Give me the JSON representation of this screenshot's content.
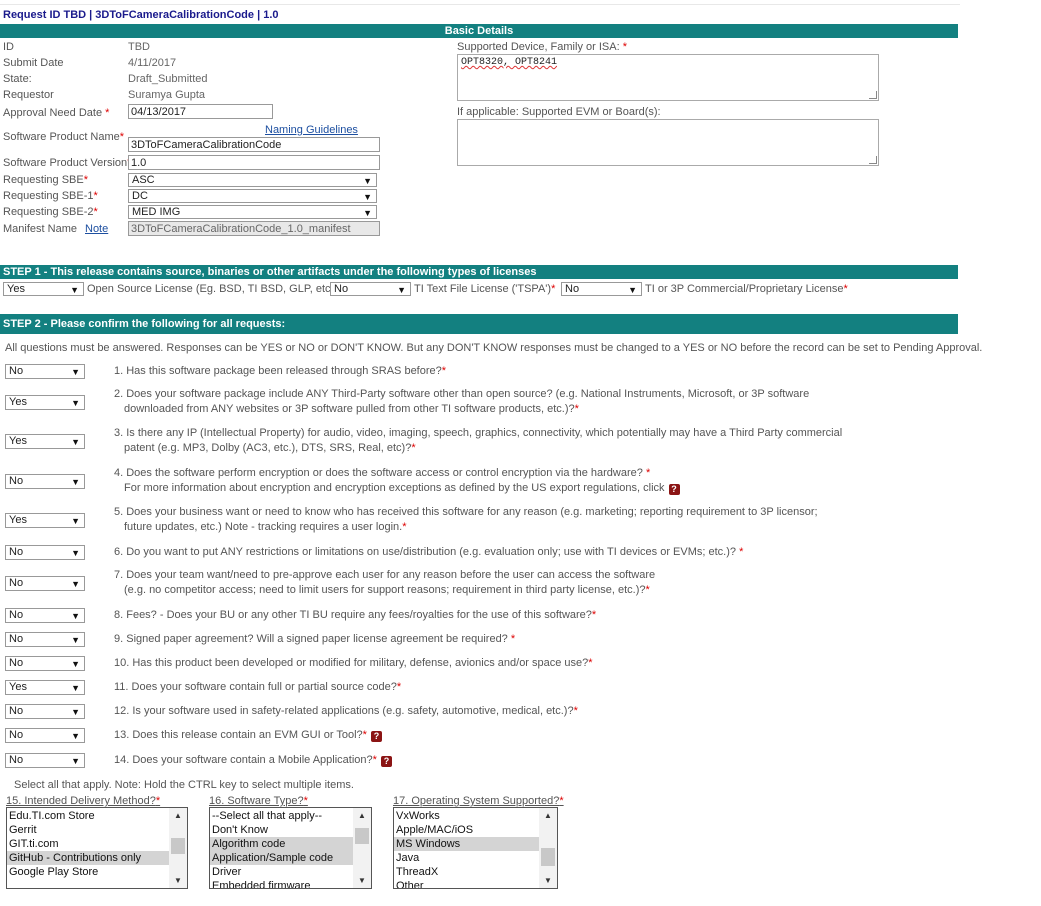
{
  "header": {
    "title": "Request ID TBD | 3DToFCameraCalibrationCode | 1.0"
  },
  "basic": {
    "bar": "Basic Details",
    "id_label": "ID",
    "id_value": "TBD",
    "submit_label": "Submit Date",
    "submit_value": "4/11/2017",
    "state_label": "State:",
    "state_value": "Draft_Submitted",
    "requestor_label": "Requestor",
    "requestor_value": "Suramya Gupta",
    "approval_label": "Approval Need Date",
    "approval_value": "04/13/2017",
    "naming_link": "Naming Guidelines",
    "product_name_label": "Software Product Name",
    "product_name_value": "3DToFCameraCalibrationCode",
    "product_version_label": "Software Product Version",
    "product_version_value": "1.0",
    "sbe_label": "Requesting SBE",
    "sbe_value": "ASC",
    "sbe1_label": "Requesting SBE-1",
    "sbe1_value": "DC",
    "sbe2_label": "Requesting SBE-2",
    "sbe2_value": "MED IMG",
    "manifest_label": "Manifest Name",
    "manifest_link": "Note",
    "manifest_value": "3DToFCameraCalibrationCode_1.0_manifest",
    "device_label": "Supported Device, Family or ISA:",
    "device_value": "OPT8320, OPT8241",
    "evm_label": "If applicable: Supported EVM or Board(s):",
    "evm_value": ""
  },
  "step1": {
    "bar": "STEP 1 - This release contains source, binaries or other artifacts under the following types of licenses",
    "open_value": "Yes",
    "open_label": "Open Source License (Eg. BSD, TI BSD, GLP, etc)",
    "tspa_value": "No",
    "tspa_label": "TI Text File License ('TSPA')",
    "commercial_value": "No",
    "commercial_label": "TI or 3P Commercial/Proprietary License"
  },
  "step2": {
    "bar": "STEP 2 - Please confirm the following for all requests:",
    "intro": "All questions must be answered. Responses can be YES or NO or DON'T KNOW. But any DON'T KNOW responses must be changed to a YES or NO before the record can be set to Pending Approval.",
    "questions": [
      {
        "answer": "No",
        "line1": "1. Has this software package been released through SRAS before?",
        "line2": ""
      },
      {
        "answer": "Yes",
        "line1": "2. Does your software package include ANY Third-Party software other than open source? (e.g. National Instruments, Microsoft, or 3P software",
        "line2": "downloaded from ANY websites or 3P software pulled from other TI software products, etc.)?"
      },
      {
        "answer": "Yes",
        "line1": "3. Is there any IP (Intellectual Property) for audio, video, imaging, speech, graphics, connectivity, which potentially may have a Third Party commercial",
        "line2": "patent (e.g. MP3, Dolby (AC3, etc.), DTS, SRS, Real, etc)?"
      },
      {
        "answer": "No",
        "line1": "4. Does the software perform encryption or does the software access or control encryption via the hardware? ",
        "line2": "For more information about encryption and encryption exceptions as defined by the US export regulations, click"
      },
      {
        "answer": "Yes",
        "line1": "5. Does your business want or need to know who has received this software for any reason (e.g. marketing; reporting requirement to 3P licensor;",
        "line2": "future updates, etc.) Note - tracking requires a user login."
      },
      {
        "answer": "No",
        "line1": "6. Do you want to put ANY restrictions or limitations on use/distribution (e.g. evaluation only; use with TI devices or EVMs; etc.)? ",
        "line2": ""
      },
      {
        "answer": "No",
        "line1": "7. Does your team want/need to pre-approve each user for any reason before the user can access the software",
        "line2": "(e.g. no competitor access; need to limit users for support reasons; requirement in third party license, etc.)?"
      },
      {
        "answer": "No",
        "line1": "8. Fees? - Does your BU or any other TI BU require any fees/royalties for the use of this software?",
        "line2": ""
      },
      {
        "answer": "No",
        "line1": "9. Signed paper agreement? Will a signed paper license agreement be required? ",
        "line2": ""
      },
      {
        "answer": "No",
        "line1": "10. Has this product been developed or modified for military, defense, avionics and/or space use?",
        "line2": ""
      },
      {
        "answer": "Yes",
        "line1": "11. Does your software contain full or partial source code?",
        "line2": ""
      },
      {
        "answer": "No",
        "line1": "12. Is your software used in safety-related applications (e.g. safety, automotive, medical, etc.)?",
        "line2": ""
      },
      {
        "answer": "No",
        "line1": "13. Does this release contain an EVM GUI or Tool?",
        "line2": ""
      },
      {
        "answer": "No",
        "line1": "14. Does your software contain a Mobile Application?",
        "line2": ""
      }
    ],
    "select_note": "Select all that apply. Note: Hold the CTRL key to select multiple items.",
    "delivery_label": "15. Intended Delivery Method?",
    "delivery_options": [
      {
        "label": "Edu.TI.com Store",
        "selected": false
      },
      {
        "label": "Gerrit",
        "selected": false
      },
      {
        "label": "GIT.ti.com",
        "selected": false
      },
      {
        "label": "GitHub - Contributions only",
        "selected": true
      },
      {
        "label": "Google Play Store",
        "selected": false
      }
    ],
    "type_label": "16. Software Type?",
    "type_options": [
      {
        "label": "--Select all that apply--",
        "selected": false
      },
      {
        "label": "Don't Know",
        "selected": false
      },
      {
        "label": "Algorithm code",
        "selected": true
      },
      {
        "label": "Application/Sample code",
        "selected": true
      },
      {
        "label": "Driver",
        "selected": false
      },
      {
        "label": "Embedded firmware",
        "selected": false
      }
    ],
    "os_label": "17. Operating System Supported?",
    "os_options": [
      {
        "label": "VxWorks",
        "selected": false
      },
      {
        "label": "Apple/MAC/iOS",
        "selected": false
      },
      {
        "label": "MS Windows",
        "selected": true
      },
      {
        "label": "Java",
        "selected": false
      },
      {
        "label": "ThreadX",
        "selected": false
      },
      {
        "label": "Other",
        "selected": false
      }
    ],
    "required_mark": "*",
    "help_icon": "?"
  }
}
